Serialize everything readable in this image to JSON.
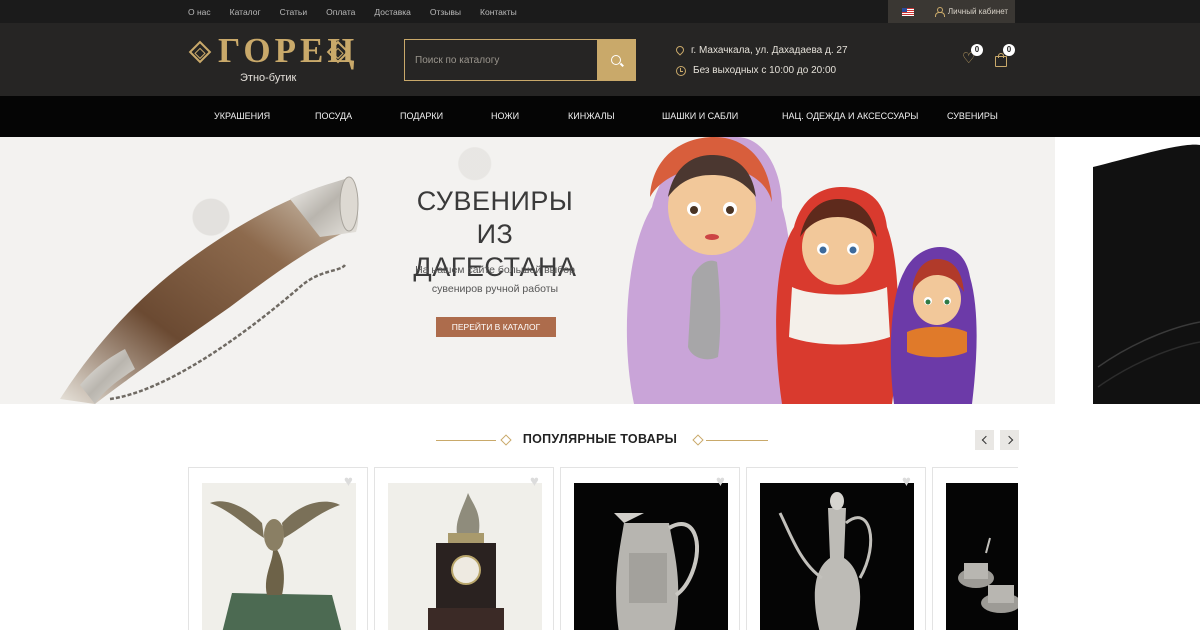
{
  "topbar": {
    "links": [
      "О нас",
      "Каталог",
      "Статьи",
      "Оплата",
      "Доставка",
      "Отзывы",
      "Контакты"
    ],
    "account_label": "Личный кабинет",
    "lang_icon": "us-flag-icon"
  },
  "header": {
    "logo_word": "ГОРЕЦ",
    "logo_sub": "Этно-бутик",
    "search_placeholder": "Поиск по каталогу",
    "address": "г. Махачкала, ул. Дахадаева д. 27",
    "hours": "Без выходных с 10:00 до 20:00",
    "wishlist_count": "0",
    "cart_count": "0"
  },
  "nav": {
    "items": [
      "УКРАШЕНИЯ",
      "ПОСУДА",
      "ПОДАРКИ",
      "НОЖИ",
      "КИНЖАЛЫ",
      "ШАШКИ И САБЛИ",
      "НАЦ. ОДЕЖДА И АКСЕССУАРЫ",
      "СУВЕНИРЫ"
    ]
  },
  "banner": {
    "title_line1": "СУВЕНИРЫ",
    "title_line2": "ИЗ ДАГЕСТАНА",
    "text_line1": "На нашем сайте большой выбор",
    "text_line2": "сувениров ручной работы",
    "button": "ПЕРЕЙТИ В КАТАЛОГ"
  },
  "popular": {
    "title": "ПОПУЛЯРНЫЕ ТОВАРЫ",
    "products": [
      {
        "image": "eagle-statuette"
      },
      {
        "image": "horseman-clock"
      },
      {
        "image": "silver-jug"
      },
      {
        "image": "silver-kumgan"
      },
      {
        "image": "silver-cups-set"
      }
    ]
  },
  "colors": {
    "accent": "#c9a96a",
    "header_bg": "#262524",
    "nav_bg": "#050505",
    "button_bg": "#ad6c4c"
  }
}
